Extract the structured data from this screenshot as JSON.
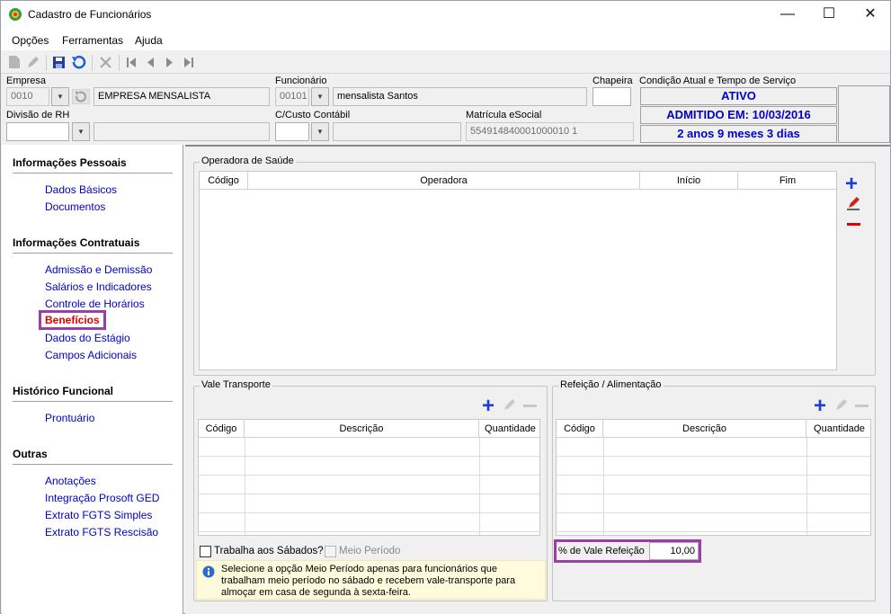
{
  "window": {
    "title": "Cadastro de Funcionários",
    "controls": {
      "minimize": "—",
      "maximize": "☐",
      "close": "✕"
    }
  },
  "menu": [
    {
      "label": "Opções"
    },
    {
      "label": "Ferramentas"
    },
    {
      "label": "Ajuda"
    }
  ],
  "header": {
    "empresa": {
      "label": "Empresa",
      "code": "0010",
      "name": "EMPRESA MENSALISTA"
    },
    "funcionario": {
      "label": "Funcionário",
      "code": "00101",
      "name": "mensalista Santos"
    },
    "chapeira": {
      "label": "Chapeira",
      "value": ""
    },
    "divisao": {
      "label": "Divisão de RH",
      "value": ""
    },
    "ccusto": {
      "label": "C/Custo Contábil",
      "value": ""
    },
    "matricula": {
      "label": "Matrícula eSocial",
      "value": "554914840001000010 1"
    },
    "condicao": {
      "label": "Condição Atual e Tempo de Serviço",
      "status": "ATIVO",
      "admitido": "ADMITIDO EM: 10/03/2016",
      "tempo": "2 anos 9 meses 3 dias"
    }
  },
  "sidebar": {
    "sections": [
      {
        "title": "Informações Pessoais",
        "items": [
          "Dados Básicos",
          "Documentos"
        ]
      },
      {
        "title": "Informações Contratuais",
        "items": [
          "Admissão e Demissão",
          "Salários e Indicadores",
          "Controle de Horários",
          "Benefícios",
          "Dados do Estágio",
          "Campos Adicionais"
        ]
      },
      {
        "title": "Histórico Funcional",
        "items": [
          "Prontuário"
        ]
      },
      {
        "title": "Outras",
        "items": [
          "Anotações",
          "Integração Prosoft GED",
          "Extrato FGTS Simples",
          "Extrato FGTS Rescisão"
        ]
      }
    ],
    "active": "Benefícios"
  },
  "saude": {
    "title": "Operadora de Saúde",
    "columns": [
      "Código",
      "Operadora",
      "Início",
      "Fim"
    ]
  },
  "vale": {
    "title": "Vale Transporte",
    "columns": [
      "Código",
      "Descrição",
      "Quantidade"
    ],
    "trabalha_sabados": "Trabalha aos Sábados?",
    "meio_periodo": "Meio Período",
    "info": "Selecione a opção Meio Período apenas para funcionários que trabalham meio período no sábado e recebem vale-transporte para almoçar em casa de segunda à sexta-feira."
  },
  "refeicao": {
    "title": "Refeição / Alimentação",
    "columns": [
      "Código",
      "Descrição",
      "Quantidade"
    ],
    "percent_label": "% de Vale Refeição",
    "percent_value": "10,00"
  },
  "colors": {
    "accent": "#0000c8",
    "active_link": "#e00000",
    "highlight_border": "#9b3fa6",
    "plus": "#1a3fd6",
    "minus": "#e00000"
  }
}
